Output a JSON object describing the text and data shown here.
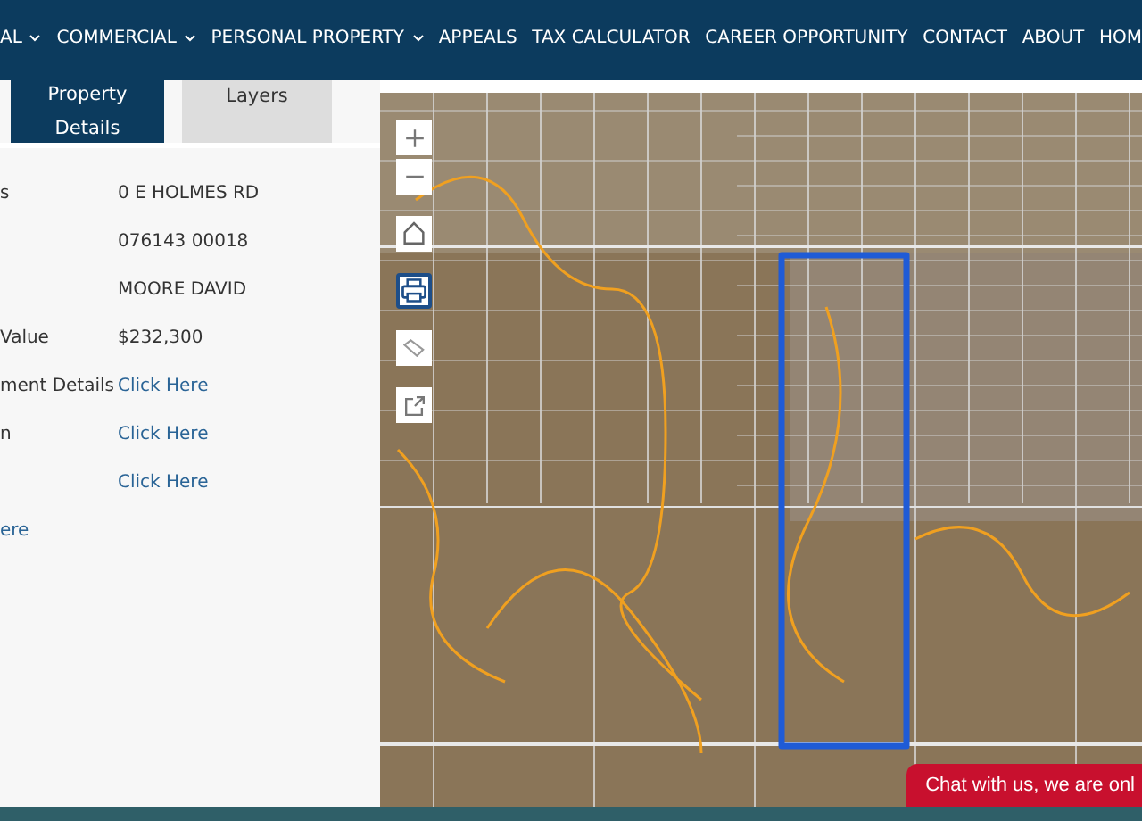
{
  "nav": [
    {
      "label": "AL",
      "dropdown": true
    },
    {
      "label": "COMMERCIAL",
      "dropdown": true
    },
    {
      "label": "PERSONAL PROPERTY",
      "dropdown": true
    },
    {
      "label": "APPEALS",
      "dropdown": false
    },
    {
      "label": "TAX CALCULATOR",
      "dropdown": false
    },
    {
      "label": "CAREER OPPORTUNITY",
      "dropdown": false
    },
    {
      "label": "CONTACT",
      "dropdown": false
    },
    {
      "label": "ABOUT",
      "dropdown": false
    },
    {
      "label": "HOM",
      "dropdown": false
    }
  ],
  "tabs": [
    {
      "label": "Property Details",
      "selected": true
    },
    {
      "label": "Layers",
      "selected": false
    }
  ],
  "details": [
    {
      "label": "s",
      "value": "0 E HOLMES RD",
      "kind": "text"
    },
    {
      "value": "076143 00018",
      "kind": "text"
    },
    {
      "value": "MOORE DAVID",
      "kind": "text"
    },
    {
      "label": "Value",
      "value": "$232,300",
      "kind": "text"
    },
    {
      "label": "ment Details",
      "value": "Click Here",
      "kind": "link"
    },
    {
      "label": "n",
      "value": "Click Here",
      "kind": "link"
    },
    {
      "value": "Click Here",
      "kind": "link"
    }
  ],
  "footer_link": "ere",
  "map_controls": [
    {
      "kind": "zoom-in",
      "selected": false
    },
    {
      "kind": "zoom-out",
      "selected": false
    },
    {
      "kind": "home",
      "selected": false
    },
    {
      "kind": "print",
      "selected": true
    },
    {
      "kind": "tag",
      "selected": false
    },
    {
      "kind": "export",
      "selected": false
    }
  ],
  "chat_button": "Chat with us, we are onl"
}
